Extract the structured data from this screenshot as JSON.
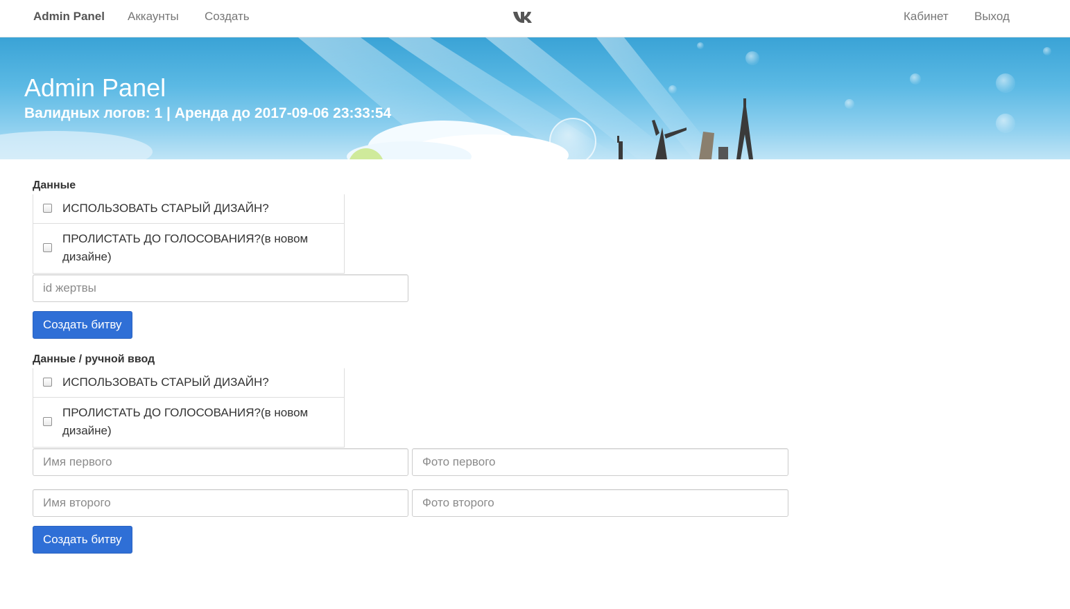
{
  "navbar": {
    "brand": "Admin Panel",
    "links": [
      "Аккаунты",
      "Создать"
    ],
    "center_icon": "vk-logo-icon",
    "right_links": [
      "Кабинет",
      "Выход"
    ]
  },
  "banner": {
    "title": "Admin Panel",
    "subtitle": "Валидных логов: 1 | Аренда до 2017-09-06 23:33:54"
  },
  "form_auto": {
    "label": "Данные",
    "options": [
      "ИСПОЛЬЗОВАТЬ СТАРЫЙ ДИЗАЙН?",
      "ПРОЛИСТАТЬ ДО ГОЛОСОВАНИЯ?(в новом дизайне)"
    ],
    "victim_id_placeholder": "id жертвы",
    "submit_label": "Создать битву"
  },
  "form_manual": {
    "label": "Данные / ручной ввод",
    "options": [
      "ИСПОЛЬЗОВАТЬ СТАРЫЙ ДИЗАЙН?",
      "ПРОЛИСТАТЬ ДО ГОЛОСОВАНИЯ?(в новом дизайне)"
    ],
    "first_name_placeholder": "Имя первого",
    "first_photo_placeholder": "Фото первого",
    "second_name_placeholder": "Имя второго",
    "second_photo_placeholder": "Фото второго",
    "submit_label": "Создать битву"
  },
  "colors": {
    "primary_button": "#2f6fd6",
    "banner_sky": "#3aa3d6",
    "nav_text": "#777777"
  }
}
